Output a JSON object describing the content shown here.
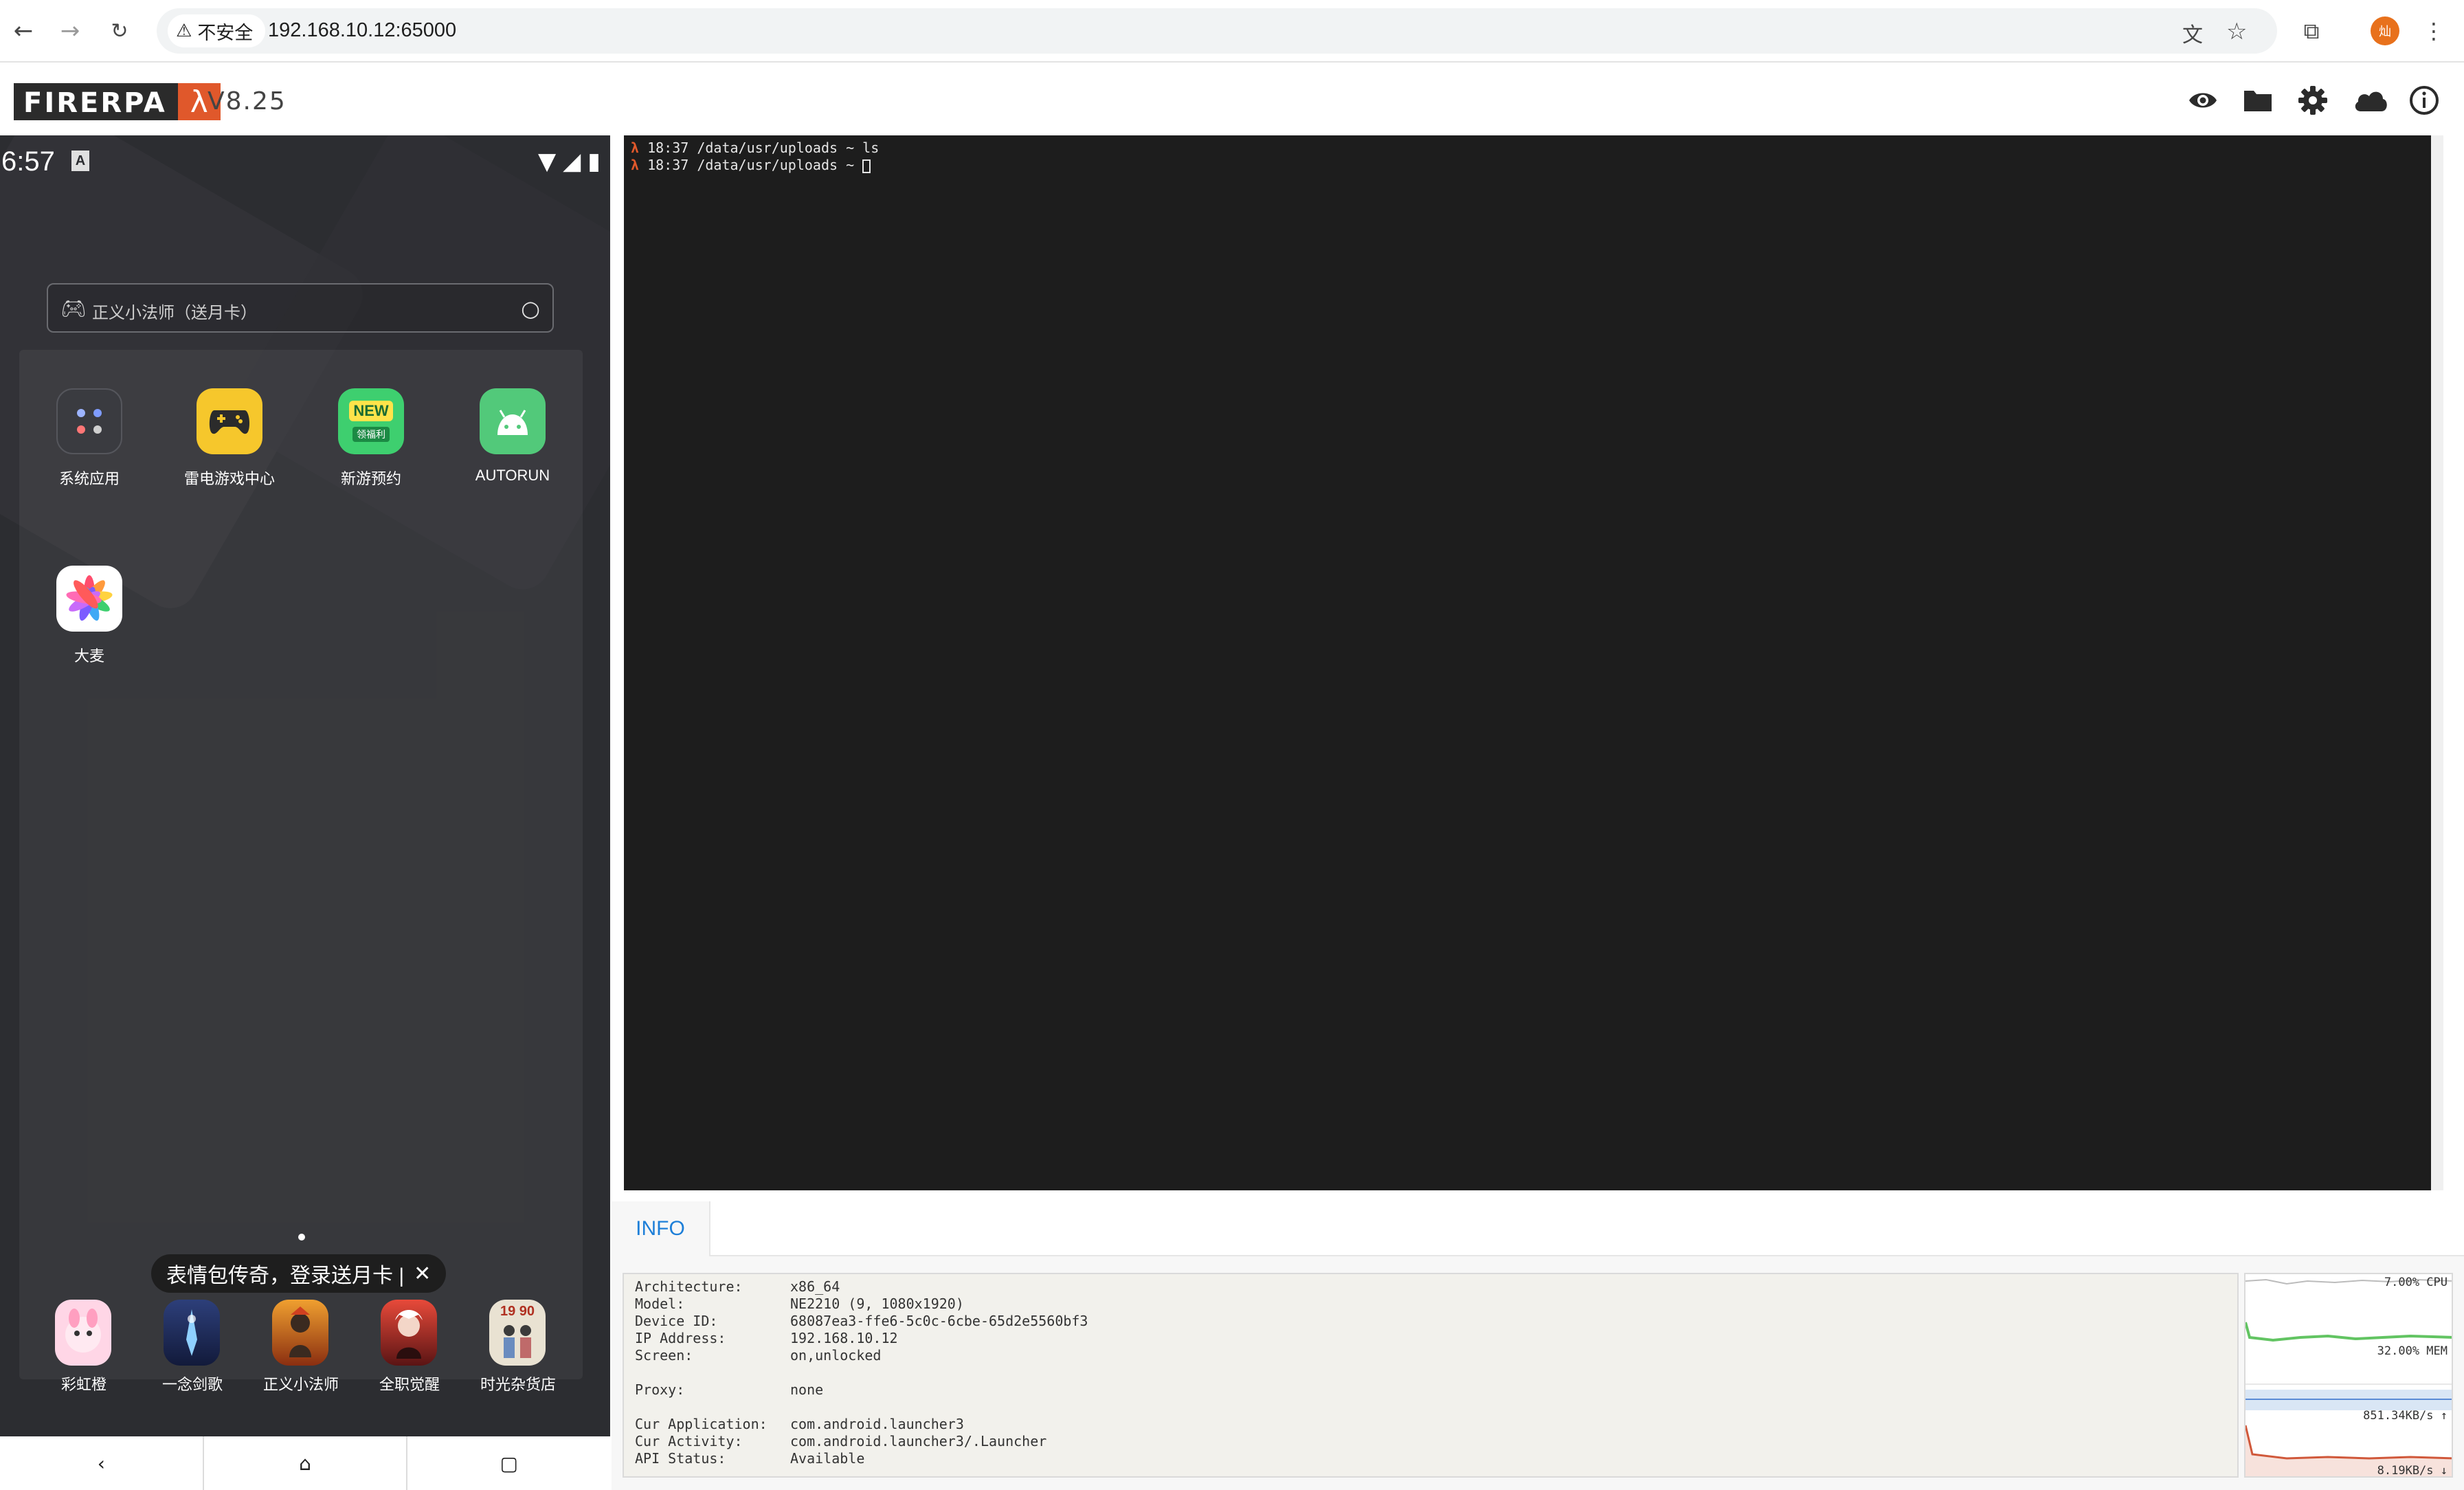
{
  "browser": {
    "security_label": "不安全",
    "url": "192.168.10.12:65000",
    "avatar_initial": "灿"
  },
  "app": {
    "logo_text": "FIRERPA",
    "logo_symbol": "λ",
    "version": "V8.25",
    "header_icons": [
      "eye-icon",
      "folder-icon",
      "gear-icon",
      "cloud-icon",
      "info-icon"
    ]
  },
  "phone": {
    "status_time": "6:57",
    "status_badge": "A",
    "search_placeholder": "正义小法师（送月卡）",
    "apps": [
      {
        "label": "系统应用"
      },
      {
        "label": "雷电游戏中心"
      },
      {
        "label": "新游预约",
        "icon_text": "NEW",
        "icon_sub": "领福利"
      },
      {
        "label": "AUTORUN"
      },
      {
        "label": "大麦"
      }
    ],
    "toast": "表情包传奇，登录送月卡 |",
    "dock": [
      {
        "label": "彩虹橙"
      },
      {
        "label": "一念剑歌"
      },
      {
        "label": "正义小法师"
      },
      {
        "label": "全职觉醒"
      },
      {
        "label": "时光杂货店",
        "icon_text": "19 90"
      }
    ]
  },
  "terminal": {
    "lines": [
      {
        "prompt": "λ",
        "text": " 18:37 /data/usr/uploads ~ ls"
      },
      {
        "prompt": "λ",
        "text": " 18:37 /data/usr/uploads ~ "
      }
    ]
  },
  "info": {
    "tab_label": "INFO",
    "rows": [
      {
        "key": "Architecture:",
        "value": "x86_64"
      },
      {
        "key": "Model:",
        "value": "NE2210 (9, 1080x1920)"
      },
      {
        "key": "Device ID:",
        "value": "68087ea3-ffe6-5c0c-6cbe-65d2e5560bf3"
      },
      {
        "key": "IP Address:",
        "value": "192.168.10.12"
      },
      {
        "key": "Screen:",
        "value": "on,unlocked"
      },
      {
        "key": "",
        "value": ""
      },
      {
        "key": "Proxy:",
        "value": "none"
      },
      {
        "key": "",
        "value": ""
      },
      {
        "key": "Cur Application:",
        "value": "com.android.launcher3"
      },
      {
        "key": "Cur Activity:",
        "value": "com.android.launcher3/.Launcher"
      },
      {
        "key": "API Status:",
        "value": "Available"
      }
    ],
    "stats": {
      "cpu": "7.00% CPU",
      "mem": "32.00% MEM",
      "upload": "851.34KB/s ↑",
      "download": "8.19KB/s ↓"
    }
  }
}
